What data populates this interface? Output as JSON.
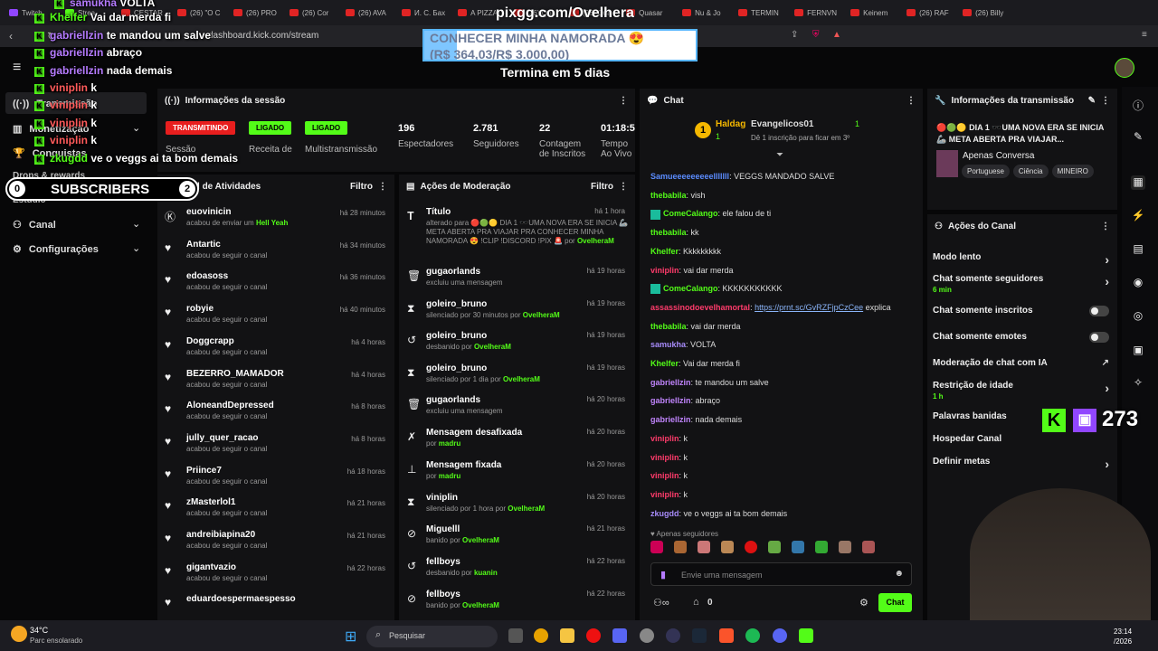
{
  "browser": {
    "tabs": [
      "Twitch",
      "Strea",
      "CESTAR",
      "(26) \"O C",
      "(26) PRO",
      "(26) Cor",
      "(26) AVA",
      "И. С. Бах",
      "A PIZZA",
      "(26) Qua",
      "(26) Qua",
      "Quasar",
      "Nu & Jo",
      "TERMIN",
      "FERNVN",
      "Keinem",
      "(26) RAF",
      "(26) Billy"
    ],
    "url": "dashboard.kick.com/stream"
  },
  "header": {
    "countdown": "Termina em 5 dias"
  },
  "overlay": {
    "pix_url": "pixgg.com/Ovelhera",
    "goal_title": "CONHECER MINHA NAMORADA 😍",
    "goal_progress": "(R$ 364,03/R$ 3.000,00)",
    "goal_fraction": 0.121,
    "subs_count": "0",
    "subs_label": "SUBSCRIBERS",
    "subs_goal": "2",
    "viewer_count": "273",
    "chat_lines": [
      {
        "user": "samukha",
        "msg": "VOLTA",
        "c": "u2"
      },
      {
        "user": "Khelfer",
        "msg": "Vai dar merda fi",
        "c": "u"
      },
      {
        "user": "gabriellzin",
        "msg": "te mandou um salve",
        "c": "u2"
      },
      {
        "user": "gabriellzin",
        "msg": "abraço",
        "c": "u2"
      },
      {
        "user": "gabriellzin",
        "msg": "nada demais",
        "c": "u2"
      },
      {
        "user": "viniplin",
        "msg": "k",
        "c": "u3"
      },
      {
        "user": "viniplin",
        "msg": "k",
        "c": "u3"
      },
      {
        "user": "viniplin",
        "msg": "k",
        "c": "u3"
      },
      {
        "user": "viniplin",
        "msg": "k",
        "c": "u3"
      },
      {
        "user": "zkugdd",
        "msg": "ve o veggs ai ta bom demais",
        "c": "u"
      }
    ]
  },
  "leftnav": {
    "items": [
      "Transmissão",
      "Monetização",
      "Conquistas",
      "Drops & rewards",
      "Estúdio",
      "Canal",
      "Configurações"
    ]
  },
  "session": {
    "title": "Informações da sessão",
    "badges": [
      "TRANSMITINDO",
      "LIGADO",
      "LIGADO"
    ],
    "labels": [
      "Sessão",
      "Receita de",
      "Multistransmissão"
    ],
    "stats": [
      {
        "value": "196",
        "label": "Espectadores"
      },
      {
        "value": "2.781",
        "label": "Seguidores"
      },
      {
        "value": "22",
        "label": "Contagem de Inscritos"
      },
      {
        "value": "01:18:5",
        "label": "Tempo Ao Vivo"
      }
    ]
  },
  "feed": {
    "title": "Feed de Atividades",
    "filter": "Filtro",
    "items": [
      {
        "name": "euovinicin",
        "sub": "acabou de enviar um",
        "extra": "Hell Yeah",
        "time": "há 28 minutos",
        "icon": "kick-icon"
      },
      {
        "name": "Antartic",
        "sub": "acabou de seguir o canal",
        "time": "há 34 minutos",
        "icon": "heart-icon"
      },
      {
        "name": "edoasoss",
        "sub": "acabou de seguir o canal",
        "time": "há 36 minutos",
        "icon": "heart-icon"
      },
      {
        "name": "robyie",
        "sub": "acabou de seguir o canal",
        "time": "há 40 minutos",
        "icon": "heart-icon"
      },
      {
        "name": "Doggcrapp",
        "sub": "acabou de seguir o canal",
        "time": "há 4 horas",
        "icon": "heart-icon"
      },
      {
        "name": "BEZERRO_MAMADOR",
        "sub": "acabou de seguir o canal",
        "time": "há 4 horas",
        "icon": "heart-icon"
      },
      {
        "name": "AloneandDepressed",
        "sub": "acabou de seguir o canal",
        "time": "há 8 horas",
        "icon": "heart-icon"
      },
      {
        "name": "jully_quer_racao",
        "sub": "acabou de seguir o canal",
        "time": "há 8 horas",
        "icon": "heart-icon"
      },
      {
        "name": "Priince7",
        "sub": "acabou de seguir o canal",
        "time": "há 18 horas",
        "icon": "heart-icon"
      },
      {
        "name": "zMasterlol1",
        "sub": "acabou de seguir o canal",
        "time": "há 21 horas",
        "icon": "heart-icon"
      },
      {
        "name": "andreibiapina20",
        "sub": "acabou de seguir o canal",
        "time": "há 21 horas",
        "icon": "heart-icon"
      },
      {
        "name": "gigantvazio",
        "sub": "acabou de seguir o canal",
        "time": "há 22 horas",
        "icon": "heart-icon"
      },
      {
        "name": "eduardoespermaespesso",
        "sub": "",
        "time": "",
        "icon": "heart-icon"
      }
    ]
  },
  "moderation": {
    "title": "Ações de Moderação",
    "filter": "Filtro",
    "title_change": {
      "name": "Título",
      "time": "há 1 hora",
      "text": "alterado para 🔴🟢🟡 DIA 1 🕶️UMA NOVA ERA SE INICIA 🦾 META ABERTA PRA VIAJAR PRA CONHECER MINHA NAMORADA 😍 !CLIP !DISCORD !PIX 🚨 por",
      "by": "OvelheraM"
    },
    "items": [
      {
        "name": "gugaorlands",
        "sub": "excluiu uma mensagem",
        "by": "",
        "time": "há 19 horas",
        "icon": "trash-icon"
      },
      {
        "name": "goleiro_bruno",
        "sub": "silenciado por 30 minutos por",
        "by": "OvelheraM",
        "time": "há 19 horas",
        "icon": "hourglass-icon"
      },
      {
        "name": "goleiro_bruno",
        "sub": "desbanido por",
        "by": "OvelheraM",
        "time": "há 19 horas",
        "icon": "undo-icon"
      },
      {
        "name": "goleiro_bruno",
        "sub": "silenciado por 1 dia por",
        "by": "OvelheraM",
        "time": "há 19 horas",
        "icon": "hourglass-icon"
      },
      {
        "name": "gugaorlands",
        "sub": "excluiu uma mensagem",
        "by": "",
        "time": "há 20 horas",
        "icon": "trash-icon"
      },
      {
        "name": "Mensagem desafixada",
        "sub": "por",
        "by": "madru",
        "time": "há 20 horas",
        "icon": "unpin-icon"
      },
      {
        "name": "Mensagem fixada",
        "sub": "por",
        "by": "madru",
        "time": "há 20 horas",
        "icon": "pin-icon"
      },
      {
        "name": "viniplin",
        "sub": "silenciado por 1 hora por",
        "by": "OvelheraM",
        "time": "há 20 horas",
        "icon": "hourglass-icon"
      },
      {
        "name": "Miguelll",
        "sub": "banido por",
        "by": "OvelheraM",
        "time": "há 21 horas",
        "icon": "ban-icon"
      },
      {
        "name": "fellboys",
        "sub": "desbanido por",
        "by": "kuanin",
        "time": "há 22 horas",
        "icon": "undo-icon"
      },
      {
        "name": "fellboys",
        "sub": "banido por",
        "by": "OvelheraM",
        "time": "há 22 horas",
        "icon": "ban-icon"
      }
    ]
  },
  "chat": {
    "title": "Chat",
    "pinned": {
      "user1": "Haldag",
      "count1": "1",
      "user2": "Evangelicos01",
      "count2": "1",
      "sub": "Dê 1 inscrição para ficar em 3º"
    },
    "messages": [
      {
        "user": "Samueeeeeeeeelllllll",
        "color": "#5b8cff",
        "msg": "VEGGS MANDADO SALVE"
      },
      {
        "user": "thebabila",
        "color": "#53fc18",
        "msg": "vish"
      },
      {
        "user": "ComeCalango",
        "color": "#53fc18",
        "msg": "ele falou de ti",
        "emblem": true
      },
      {
        "user": "thebabila",
        "color": "#53fc18",
        "msg": "kk"
      },
      {
        "user": "Khelfer",
        "color": "#53fc18",
        "msg": "Kkkkkkkkk"
      },
      {
        "user": "viniplin",
        "color": "#ff3b6b",
        "msg": "vai dar merda"
      },
      {
        "user": "ComeCalango",
        "color": "#53fc18",
        "msg": "KKKKKKKKKKK",
        "emblem": true
      },
      {
        "user": "assassinodoevelhamortal",
        "color": "#ff3b6b",
        "msg": "",
        "link": "https://prnt.sc/GvRZFjpCzCee",
        "after": "explica"
      },
      {
        "user": "thebabila",
        "color": "#53fc18",
        "msg": "vai dar merda"
      },
      {
        "user": "samukha",
        "color": "#a78bfa",
        "msg": "VOLTA"
      },
      {
        "user": "Khelfer",
        "color": "#53fc18",
        "msg": "Vai dar merda fi"
      },
      {
        "user": "gabriellzin",
        "color": "#c084fc",
        "msg": "te mandou um salve"
      },
      {
        "user": "gabriellzin",
        "color": "#c084fc",
        "msg": "abraço"
      },
      {
        "user": "gabriellzin",
        "color": "#c084fc",
        "msg": "nada demais"
      },
      {
        "user": "viniplin",
        "color": "#ff3b6b",
        "msg": "k"
      },
      {
        "user": "viniplin",
        "color": "#ff3b6b",
        "msg": "k"
      },
      {
        "user": "viniplin",
        "color": "#ff3b6b",
        "msg": "k"
      },
      {
        "user": "viniplin",
        "color": "#ff3b6b",
        "msg": "k"
      },
      {
        "user": "zkugdd",
        "color": "#a78bfa",
        "msg": "ve o veggs ai ta bom demais"
      }
    ],
    "followers_only": "Apenas seguidores",
    "input_placeholder": "Envie uma mensagem",
    "gift_count": "0",
    "send_label": "Chat"
  },
  "stream_info": {
    "title": "Informações da transmissão",
    "stream_title": "🔴🟢🟡 DIA 1 🕶️UMA NOVA ERA SE INICIA 🦾 META ABERTA PRA VIAJAR...",
    "category": "Apenas Conversa",
    "tags": [
      "Portuguese",
      "Ciência",
      "MINEIRO"
    ]
  },
  "channel_actions": {
    "title": "Ações do Canal",
    "rows": [
      {
        "label": "Modo lento",
        "sub": "",
        "control": "arrow"
      },
      {
        "label": "Chat somente seguidores",
        "sub": "6 min",
        "control": "arrow"
      },
      {
        "label": "Chat somente inscritos",
        "sub": "",
        "control": "toggle"
      },
      {
        "label": "Chat somente emotes",
        "sub": "",
        "control": "toggle"
      },
      {
        "label": "Moderação de chat com IA",
        "sub": "",
        "control": "external"
      },
      {
        "label": "Restrição de idade",
        "sub": "1 h",
        "control": "arrow"
      },
      {
        "label": "Palavras banidas",
        "sub": "",
        "control": "none"
      },
      {
        "label": "Hospedar Canal",
        "sub": "",
        "control": "none"
      },
      {
        "label": "Definir metas",
        "sub": "",
        "control": "arrow"
      }
    ]
  },
  "taskbar": {
    "temp": "34°C",
    "weather": "Parc ensolarado",
    "search": "Pesquisar",
    "time": "23:14",
    "date": "/2026"
  }
}
